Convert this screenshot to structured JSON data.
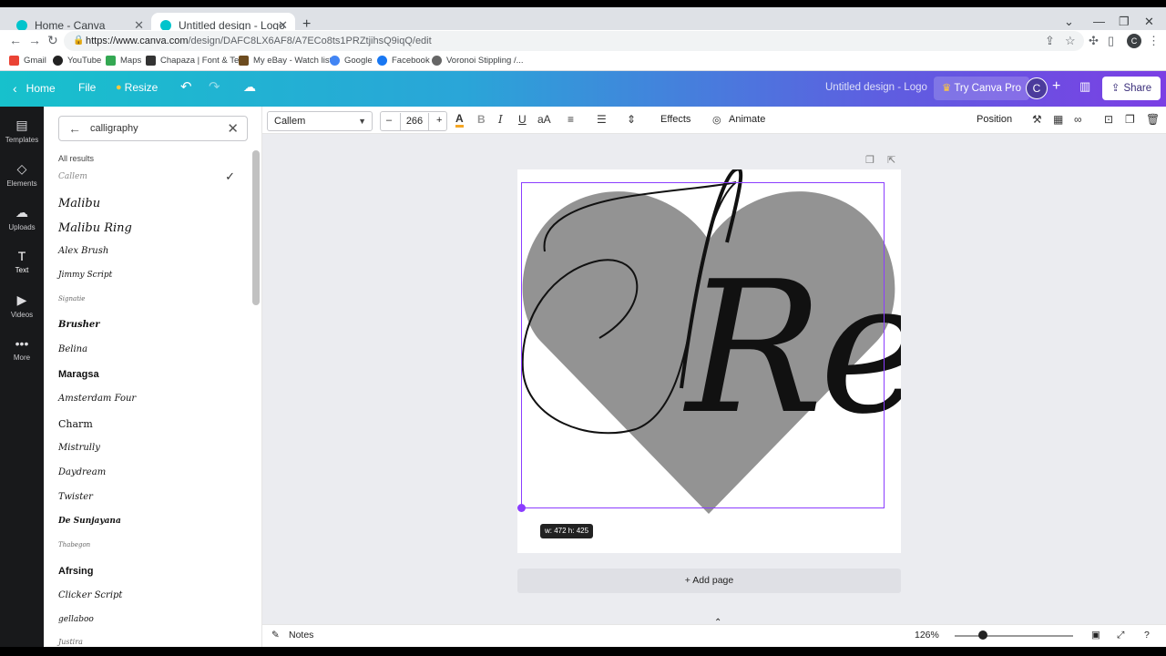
{
  "browser": {
    "tabs": [
      {
        "title": "Home - Canva",
        "active": false
      },
      {
        "title": "Untitled design - Logo",
        "active": true
      }
    ],
    "url_host": "https://www.canva.com",
    "url_path": "/design/DAFC8LX6AF8/A7ECo8ts1PRZtjihsQ9iqQ/edit",
    "profile_initial": "C",
    "bookmarks": [
      "Gmail",
      "YouTube",
      "Maps",
      "Chapaza | Font & Te...",
      "My eBay - Watch list",
      "Google",
      "Facebook",
      "Voronoi Stippling /..."
    ]
  },
  "header": {
    "home": "Home",
    "file": "File",
    "resize": "Resize",
    "doc_title": "Untitled design - Logo",
    "try_pro": "Try Canva Pro",
    "avatar_initial": "C",
    "share": "Share"
  },
  "rail": [
    {
      "label": "Templates",
      "icon": "template-icon"
    },
    {
      "label": "Elements",
      "icon": "elements-icon"
    },
    {
      "label": "Uploads",
      "icon": "upload-icon"
    },
    {
      "label": "Text",
      "icon": "text-icon"
    },
    {
      "label": "Videos",
      "icon": "video-icon"
    },
    {
      "label": "More",
      "icon": "more-icon"
    }
  ],
  "panel": {
    "search_value": "calligraphy",
    "results_label": "All results",
    "fonts": [
      "Callem",
      "Malibu",
      "Malibu Ring",
      "Alex Brush",
      "Jimmy Script",
      "Signatie",
      "Brusher",
      "Belina",
      "Maragsa",
      "Amsterdam Four",
      "Charm",
      "Mistrully",
      "Daydream",
      "Twister",
      "De Sunjayana",
      "Thabegon",
      "Afrsing",
      "Clicker Script",
      "gellaboo",
      "Justira"
    ]
  },
  "toolbar": {
    "font": "Callem",
    "size": "266",
    "effects": "Effects",
    "animate": "Animate",
    "position": "Position"
  },
  "canvas": {
    "text": "Rex",
    "dims": "w: 472 h: 425",
    "add_page": "+ Add page"
  },
  "bottom": {
    "notes": "Notes",
    "zoom": "126%"
  }
}
